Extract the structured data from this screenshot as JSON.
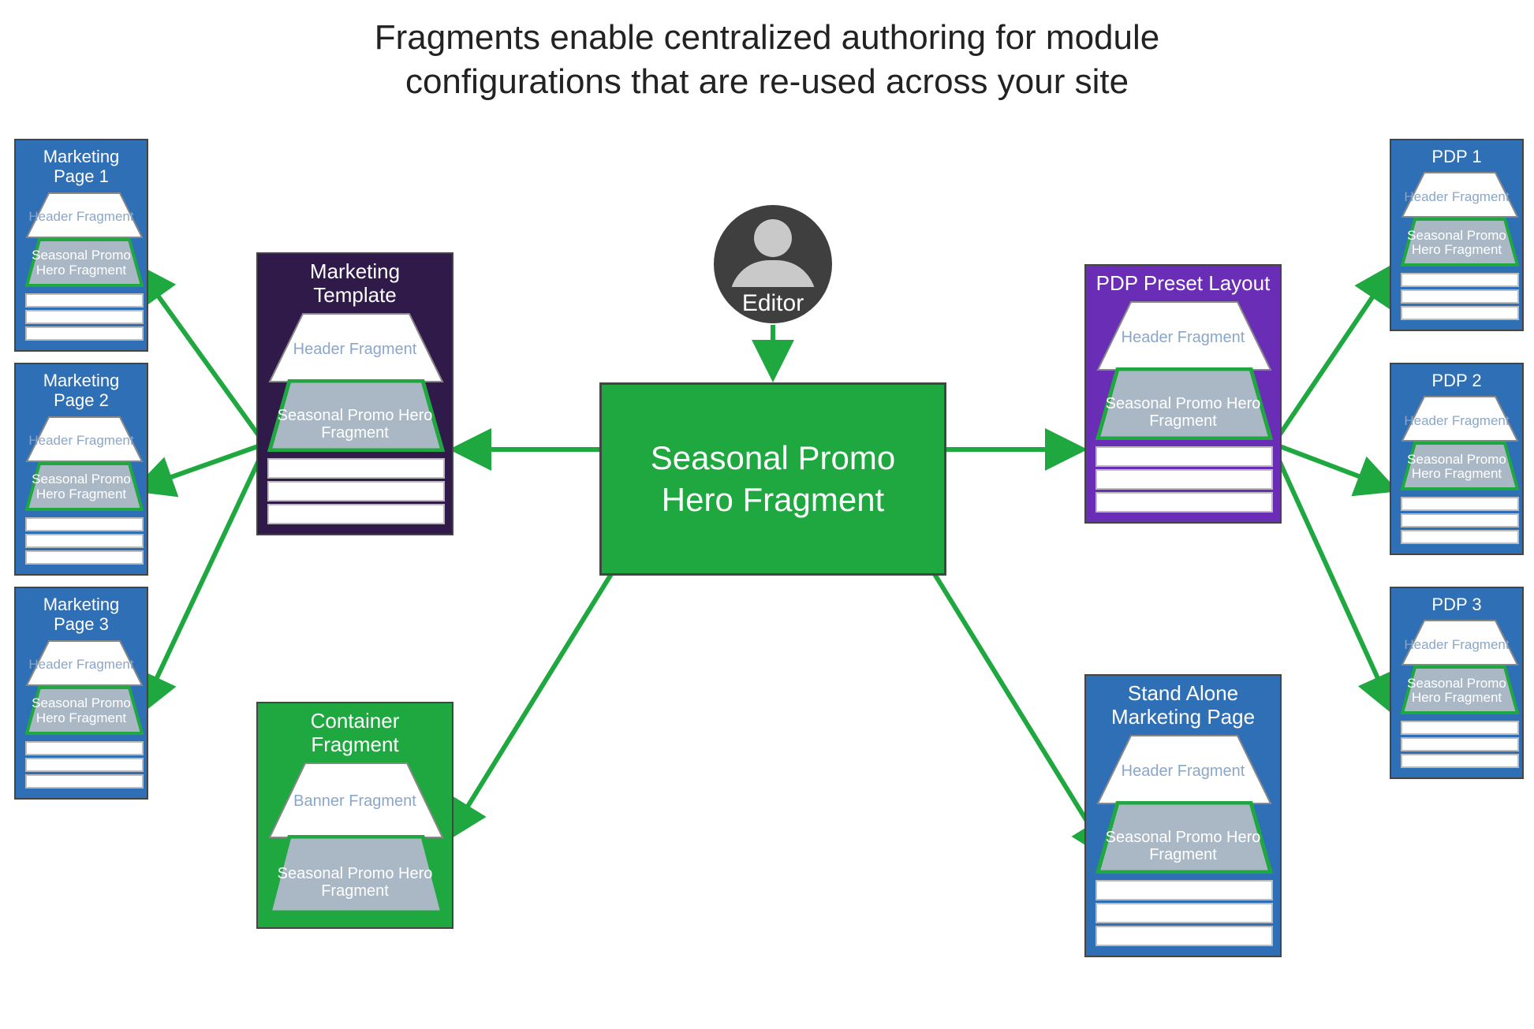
{
  "title_line1": "Fragments enable centralized authoring for module",
  "title_line2": "configurations that are re-used across your site",
  "editor_label": "Editor",
  "center_card_line1": "Seasonal Promo",
  "center_card_line2": "Hero Fragment",
  "frag_header_label": "Header Fragment",
  "frag_promo_label": "Seasonal Promo Hero Fragment",
  "frag_banner_label": "Banner Fragment",
  "left_pages": [
    {
      "title": "Marketing Page 1"
    },
    {
      "title": "Marketing Page 2"
    },
    {
      "title": "Marketing Page 3"
    }
  ],
  "right_pages": [
    {
      "title": "PDP 1"
    },
    {
      "title": "PDP 2"
    },
    {
      "title": "PDP 3"
    }
  ],
  "marketing_template_title": "Marketing Template",
  "pdp_layout_title": "PDP Preset Layout",
  "container_fragment_title": "Container Fragment",
  "standalone_title_line1": "Stand Alone",
  "standalone_title_line2": "Marketing Page"
}
